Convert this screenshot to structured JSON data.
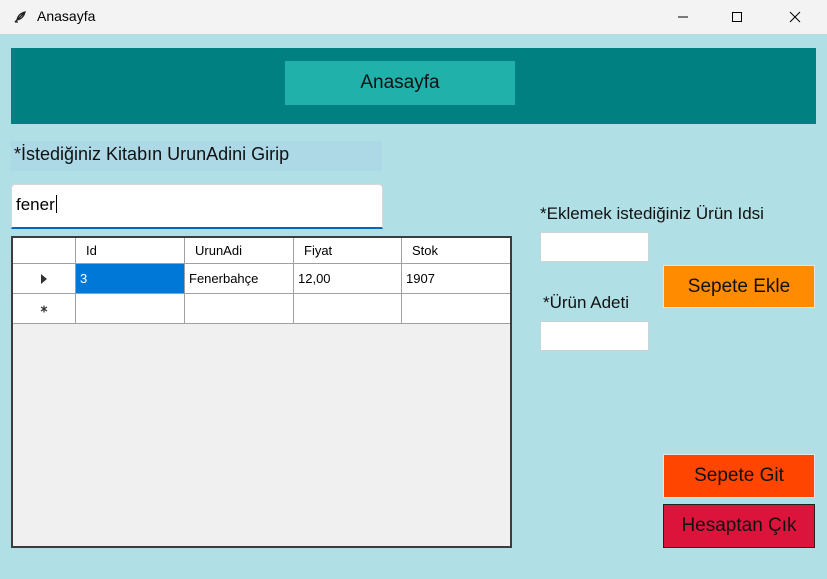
{
  "window": {
    "title": "Anasayfa",
    "controls": [
      "minimize-icon",
      "maximize-icon",
      "close-icon"
    ]
  },
  "header": {
    "button_label": "Anasayfa",
    "panel_color": "#008080",
    "button_color": "#20b2aa"
  },
  "search": {
    "instruction": "*İstediğiniz Kitabın UrunAdini Girip",
    "value": "fener"
  },
  "grid": {
    "columns": [
      "Id",
      "UrunAdi",
      "Fiyat",
      "Stok"
    ],
    "rows": [
      {
        "Id": "3",
        "UrunAdi": "Fenerbahçe",
        "Fiyat": "12,00",
        "Stok": "1907"
      }
    ],
    "current_row_marker": "▶",
    "new_row_marker": "*"
  },
  "form": {
    "urun_id_label": "*Eklemek istediğiniz Ürün Idsi",
    "urun_id_value": "",
    "adet_label": "*Ürün Adeti",
    "adet_value": ""
  },
  "buttons": {
    "sepete_ekle": "Sepete Ekle",
    "sepete_git": "Sepete Git",
    "hesaptan_cik": "Hesaptan Çık"
  },
  "colors": {
    "background": "#b0dfe5",
    "sepete_ekle": "#ff8c00",
    "sepete_git": "#ff4500",
    "hesaptan_cik": "#dc143c",
    "selection": "#0078d7"
  }
}
